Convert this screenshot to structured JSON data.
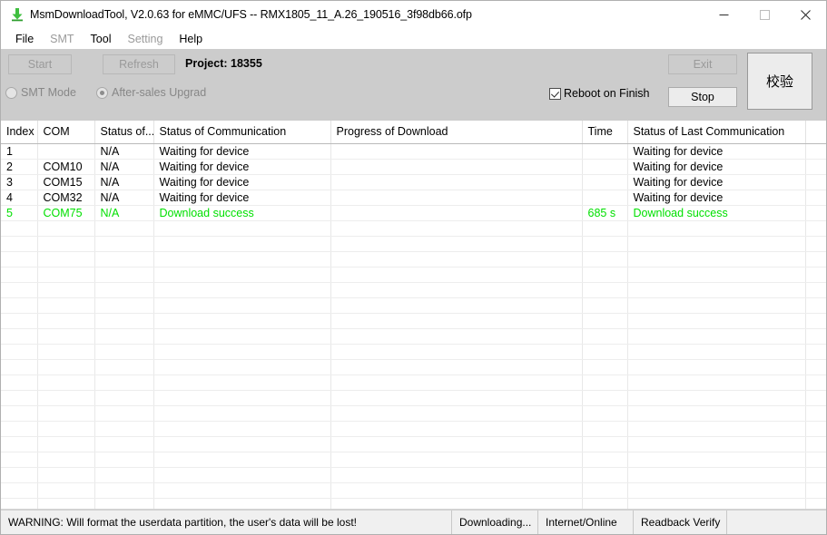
{
  "window": {
    "title": "MsmDownloadTool, V2.0.63 for eMMC/UFS -- RMX1805_11_A.26_190516_3f98db66.ofp",
    "app_icon": "download-arrow-icon",
    "controls": {
      "minimize": "minimize-icon",
      "maximize": "maximize-icon",
      "close": "close-icon"
    }
  },
  "menubar": {
    "items": [
      {
        "label": "File",
        "disabled": false
      },
      {
        "label": "SMT",
        "disabled": true
      },
      {
        "label": "Tool",
        "disabled": false
      },
      {
        "label": "Setting",
        "disabled": true
      },
      {
        "label": "Help",
        "disabled": false
      }
    ]
  },
  "toolbar": {
    "start_label": "Start",
    "refresh_label": "Refresh",
    "project_label": "Project: 18355",
    "exit_label": "Exit",
    "stop_label": "Stop",
    "verify_label": "校验",
    "smt_mode_label": "SMT Mode",
    "after_sales_label": "After-sales Upgrad",
    "reboot_label": "Reboot on Finish",
    "smt_mode_checked": false,
    "after_sales_checked": true,
    "reboot_checked": true
  },
  "table": {
    "columns": [
      "Index",
      "COM",
      "Status of...",
      "Status of Communication",
      "Progress of Download",
      "Time",
      "Status of Last Communication",
      ""
    ],
    "rows": [
      {
        "index": "1",
        "com": "",
        "status_of": "N/A",
        "status_comm": "Waiting for device",
        "progress": "",
        "time": "",
        "last_comm": "Waiting for device",
        "success": false
      },
      {
        "index": "2",
        "com": "COM10",
        "status_of": "N/A",
        "status_comm": "Waiting for device",
        "progress": "",
        "time": "",
        "last_comm": "Waiting for device",
        "success": false
      },
      {
        "index": "3",
        "com": "COM15",
        "status_of": "N/A",
        "status_comm": "Waiting for device",
        "progress": "",
        "time": "",
        "last_comm": "Waiting for device",
        "success": false
      },
      {
        "index": "4",
        "com": "COM32",
        "status_of": "N/A",
        "status_comm": "Waiting for device",
        "progress": "",
        "time": "",
        "last_comm": "Waiting for device",
        "success": false
      },
      {
        "index": "5",
        "com": "COM75",
        "status_of": "N/A",
        "status_comm": "Download success",
        "progress": "",
        "time": "685 s",
        "last_comm": "Download success",
        "success": true
      }
    ],
    "empty_rows": 19
  },
  "statusbar": {
    "warning": "WARNING: Will format the userdata partition, the user's data will be lost!",
    "downloading": "Downloading...",
    "network": "Internet/Online",
    "readback": "Readback Verify"
  },
  "colors": {
    "success_green": "#00e000",
    "toolbar_grey": "#cccccc",
    "statusbar_grey": "#f0f0f0"
  }
}
